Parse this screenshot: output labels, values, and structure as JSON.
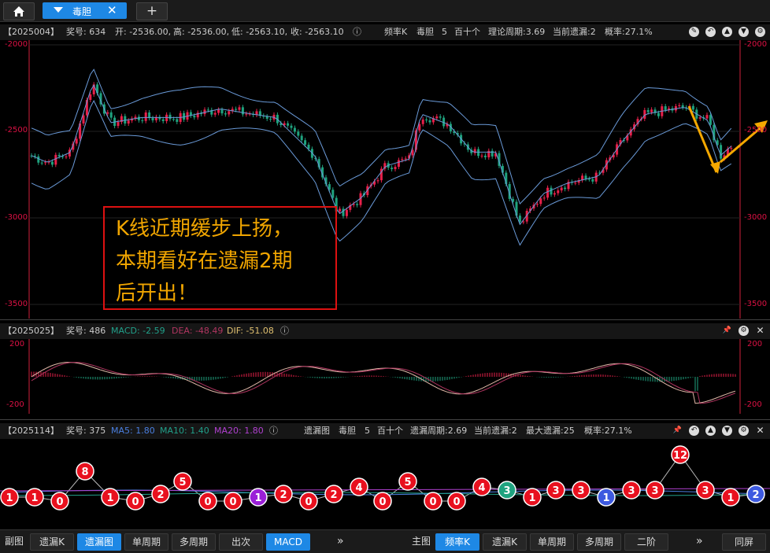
{
  "tabs": {
    "home_icon": "home-icon",
    "active_tab": "毒胆",
    "close_glyph": "✕",
    "add_glyph": "+"
  },
  "kline_panel": {
    "issue": "【2025004】",
    "prize_no": "奖号: 634",
    "open": "开: -2536.00,",
    "high": "高: -2536.00,",
    "low": "低: -2563.10,",
    "close": "收: -2563.10",
    "mode": "频率K",
    "name": "毒胆",
    "digit": "5",
    "pos": "百十个",
    "theory_period": "理论周期:3.69",
    "current_miss": "当前遗漏:2",
    "prob": "概率:27.1%",
    "y_labels": [
      "-2000",
      "-2500",
      "-3000",
      "-3500"
    ],
    "note_lines": [
      "K线近期缓步上扬，",
      "本期看好在遗漏2期",
      "后开出！"
    ]
  },
  "macd_panel": {
    "issue": "【2025025】",
    "prize_no": "奖号: 486",
    "macd": "MACD: -2.59",
    "dea": "DEA: -48.49",
    "dif": "DIF: -51.08",
    "y_labels": [
      "200",
      "-200"
    ]
  },
  "miss_panel": {
    "issue": "【2025114】",
    "prize_no": "奖号: 375",
    "ma5": "MA5: 1.80",
    "ma10": "MA10: 1.40",
    "ma20": "MA20: 1.80",
    "chart_name": "遗漏图",
    "name": "毒胆",
    "digit": "5",
    "pos": "百十个",
    "miss_period": "遗漏周期:2.69",
    "current_miss": "当前遗漏:2",
    "max_miss": "最大遗漏:25",
    "prob": "概率:27.1%",
    "bubbles": [
      "1",
      "1",
      "0",
      "8",
      "1",
      "0",
      "2",
      "5",
      "0",
      "0",
      "1",
      "2",
      "0",
      "2",
      "4",
      "0",
      "5",
      "0",
      "0",
      "4",
      "3",
      "1",
      "3",
      "3",
      "1",
      "3",
      "3",
      "12",
      "3",
      "1",
      "2"
    ]
  },
  "bottom": {
    "left_label": "副图",
    "left_buttons": [
      "遗漏K",
      "遗漏图",
      "单周期",
      "多周期",
      "出次",
      "MACD"
    ],
    "more_left": "»",
    "right_label": "主图",
    "right_buttons": [
      "频率K",
      "遗漏K",
      "单周期",
      "多周期",
      "二阶"
    ],
    "more_right": "»",
    "fullscreen": "同屏"
  },
  "colors": {
    "up": "#e8204a",
    "down": "#1fa37f",
    "band": "#6a9ad8",
    "tab_blue": "#1e88e5",
    "axis": "#d11f3c",
    "arrow": "#f5a800"
  }
}
